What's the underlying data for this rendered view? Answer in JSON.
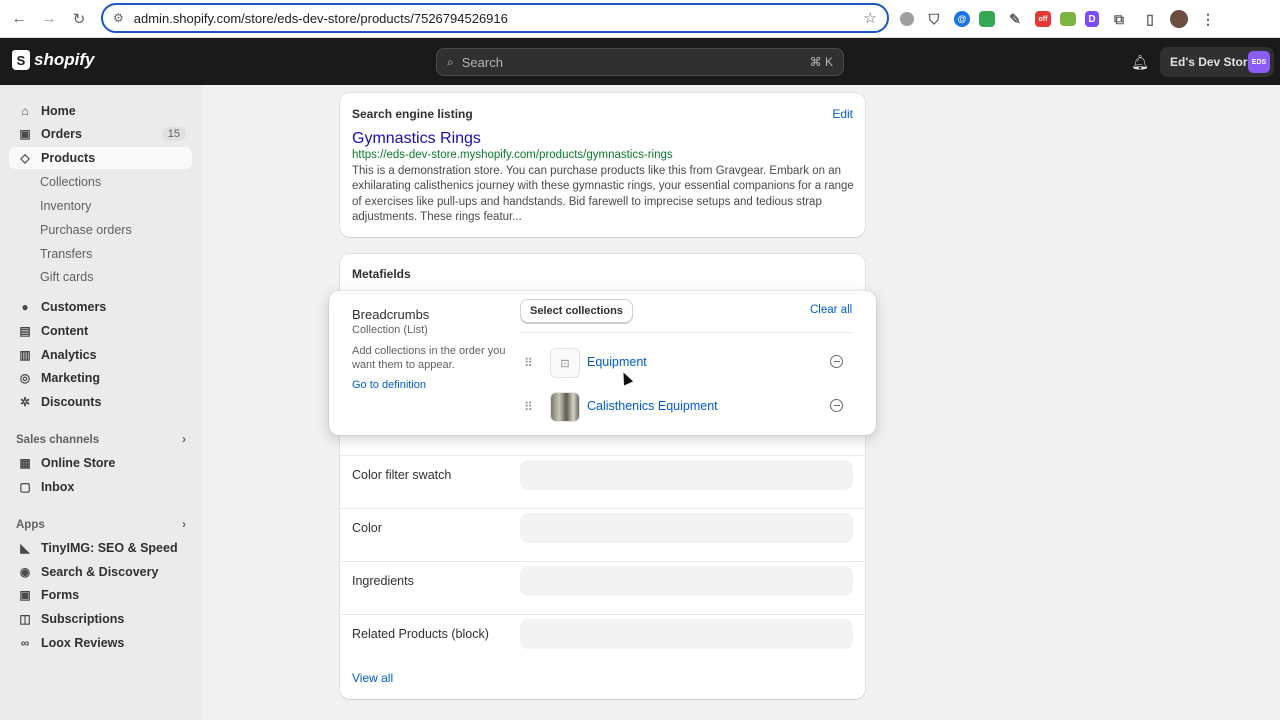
{
  "browser": {
    "url": "admin.shopify.com/store/eds-dev-store/products/7526794526916",
    "back_icon": "arrow-left-icon",
    "forward_icon": "arrow-right-icon",
    "reload_icon": "reload-icon",
    "bookmark_icon": "star-icon"
  },
  "topbar": {
    "logo_text": "shopify",
    "search_placeholder": "Search",
    "search_shortcut": "⌘ K",
    "store_name": "Ed's Dev Store",
    "store_avatar": "EDS"
  },
  "sidebar": {
    "items": [
      {
        "label": "Home",
        "icon": "home-icon"
      },
      {
        "label": "Orders",
        "icon": "orders-icon",
        "badge": "15"
      },
      {
        "label": "Products",
        "icon": "tag-icon"
      }
    ],
    "product_subitems": [
      "Collections",
      "Inventory",
      "Purchase orders",
      "Transfers",
      "Gift cards"
    ],
    "items2": [
      {
        "label": "Customers",
        "icon": "person-icon"
      },
      {
        "label": "Content",
        "icon": "content-icon"
      },
      {
        "label": "Analytics",
        "icon": "analytics-icon"
      },
      {
        "label": "Marketing",
        "icon": "marketing-icon"
      },
      {
        "label": "Discounts",
        "icon": "discount-icon"
      }
    ],
    "sales_channels_label": "Sales channels",
    "sales_channels": [
      {
        "label": "Online Store",
        "icon": "store-icon"
      },
      {
        "label": "Inbox",
        "icon": "inbox-icon"
      }
    ],
    "apps_label": "Apps",
    "apps": [
      {
        "label": "TinyIMG: SEO & Speed",
        "icon": "tinyimg-icon"
      },
      {
        "label": "Search & Discovery",
        "icon": "search-discovery-icon"
      },
      {
        "label": "Forms",
        "icon": "forms-icon"
      },
      {
        "label": "Subscriptions",
        "icon": "subscriptions-icon"
      },
      {
        "label": "Loox Reviews",
        "icon": "loox-icon"
      }
    ]
  },
  "seo": {
    "heading": "Search engine listing",
    "edit_label": "Edit",
    "page_title": "Gymnastics Rings",
    "url": "https://eds-dev-store.myshopify.com/products/gymnastics-rings",
    "description": "This is a demonstration store. You can purchase products like this from Gravgear. Embark on an exhilarating calisthenics journey with these gymnastic rings, your essential companions for a range of exercises like pull-ups and handstands. Bid farewell to imprecise setups and tedious strap adjustments. These rings featur..."
  },
  "metafields": {
    "heading": "Metafields",
    "rows": [
      {
        "label": "Color filter swatch"
      },
      {
        "label": "Color"
      },
      {
        "label": "Ingredients"
      },
      {
        "label": "Related Products (block)"
      }
    ],
    "view_all": "View all"
  },
  "breadcrumbs_editor": {
    "name": "Breadcrumbs",
    "type": "Collection (List)",
    "help": "Add collections in the order you want them to appear.",
    "definition_link": "Go to definition",
    "select_button": "Select collections",
    "clear_all": "Clear all",
    "collections": [
      {
        "name": "Equipment",
        "thumb": "image-placeholder-icon"
      },
      {
        "name": "Calisthenics Equipment",
        "thumb": "photo"
      }
    ]
  },
  "colors": {
    "link": "#005bd3",
    "topbar": "#1a1a1a",
    "seo_title": "#1a0dab",
    "seo_url": "#0b7a2b"
  }
}
